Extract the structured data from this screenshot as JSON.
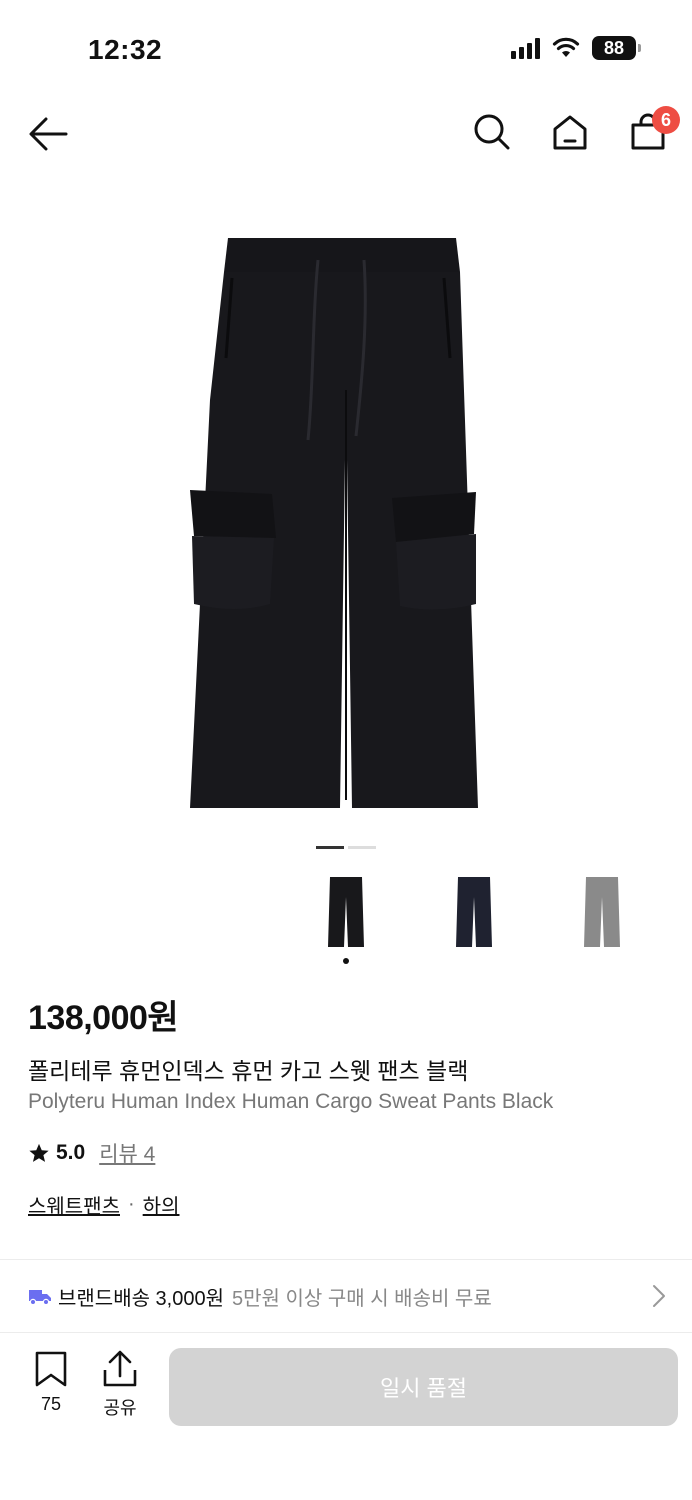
{
  "status_bar": {
    "time": "12:32",
    "battery": "88"
  },
  "header": {
    "cart_count": "6"
  },
  "product": {
    "price": "138,000원",
    "name_ko": "폴리테루 휴먼인덱스 휴먼 카고 스웻 팬츠 블랙",
    "name_en": "Polyteru Human Index Human Cargo Sweat Pants Black",
    "rating": "5.0",
    "review_label": "리뷰 4",
    "categories": [
      "스웨트팬츠",
      "하의"
    ],
    "category_separator": "·",
    "swatch_colors": [
      "#18181b",
      "#1f2230",
      "#8a8a8a"
    ],
    "image_pages": 2,
    "active_page": 1
  },
  "shipping": {
    "brand": "브랜드배송 3,000원",
    "note": "5만원 이상 구매 시 배송비 무료"
  },
  "bottom_bar": {
    "bookmark_count": "75",
    "share_label": "공유",
    "soldout_label": "일시 품절"
  },
  "colors": {
    "accent_badge": "#ee4d43",
    "truck": "#6b6ef0",
    "disabled_button": "#d3d3d3"
  }
}
